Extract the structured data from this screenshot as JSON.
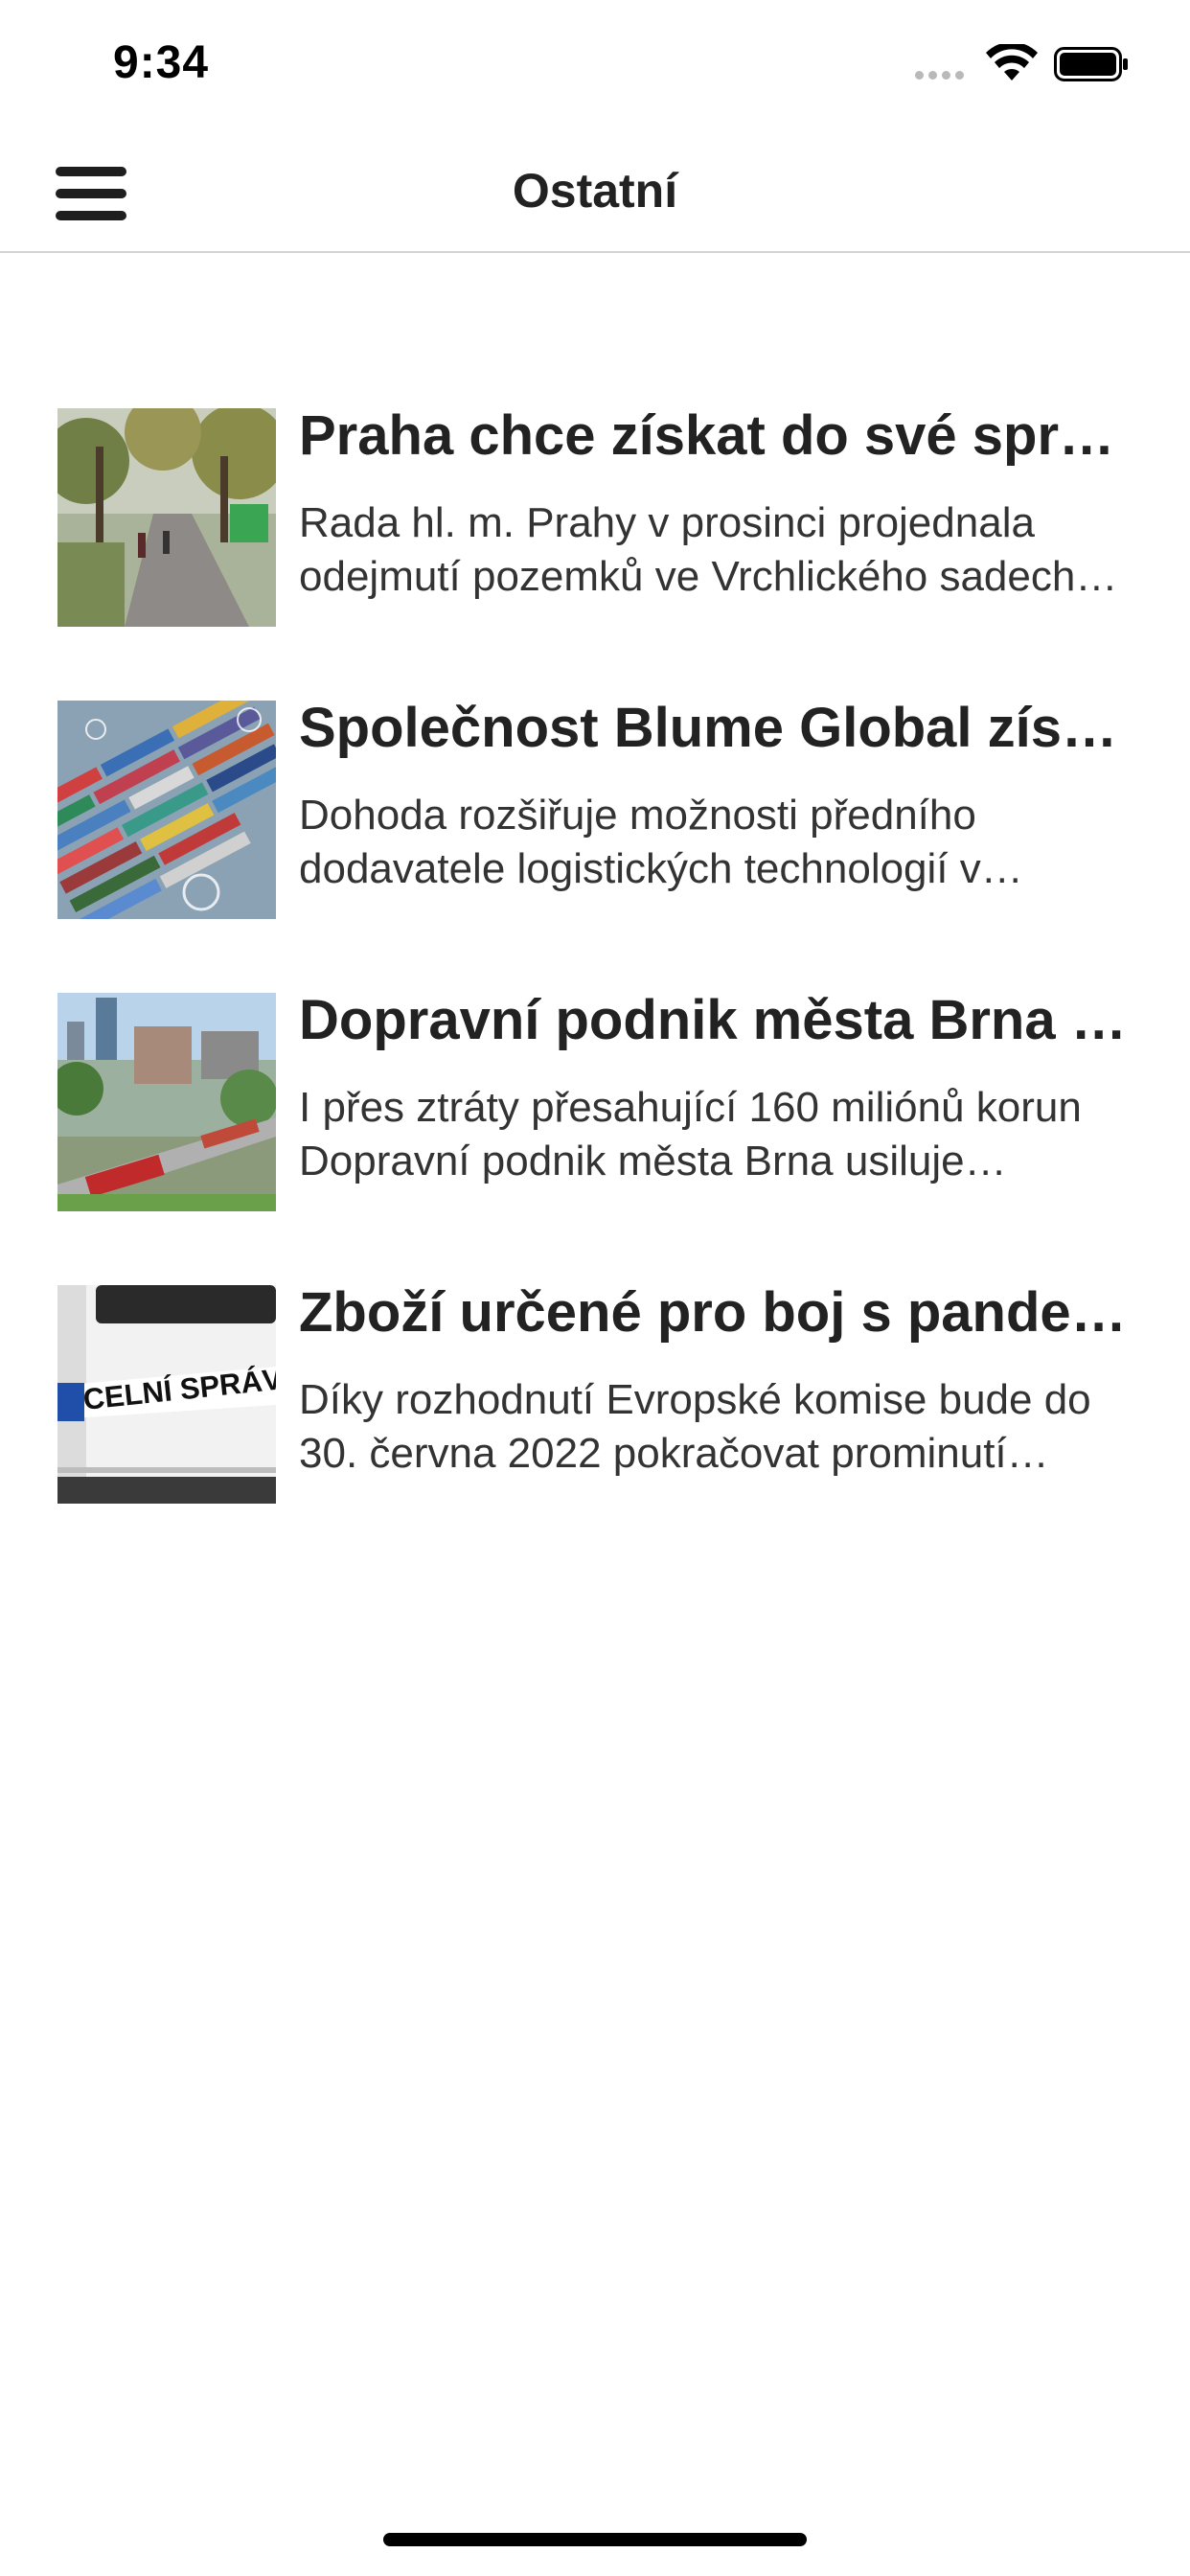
{
  "status_bar": {
    "time": "9:34",
    "wifi_icon": "wifi-icon",
    "battery_icon": "battery-icon"
  },
  "header": {
    "title": "Ostatní",
    "menu_icon": "hamburger-menu-icon"
  },
  "articles": [
    {
      "title": "Praha chce získat do své správy Vrchlického sady",
      "summary": "Rada hl. m. Prahy v prosinci projednala odejmutí pozemků ve Vrchlického sadech…",
      "image": "park-path-photo"
    },
    {
      "title": "Společnost Blume Global získala",
      "summary": "Dohoda rozšiřuje možnosti předního dodavatele logistických technologií v…",
      "image": "container-terminal-photo"
    },
    {
      "title": "Dopravní podnik města Brna i přes",
      "summary": "I přes ztráty přesahující 160 miliónů korun Dopravní podnik města Brna usiluje…",
      "image": "brno-tram-photo"
    },
    {
      "title": "Zboží určené pro boj s pandemií",
      "summary": "Díky rozhodnutí Evropské komise bude do 30. června 2022 pokračovat prominutí…",
      "image": "customs-van-photo",
      "image_text": "CELNÍ SPRÁVA"
    }
  ]
}
